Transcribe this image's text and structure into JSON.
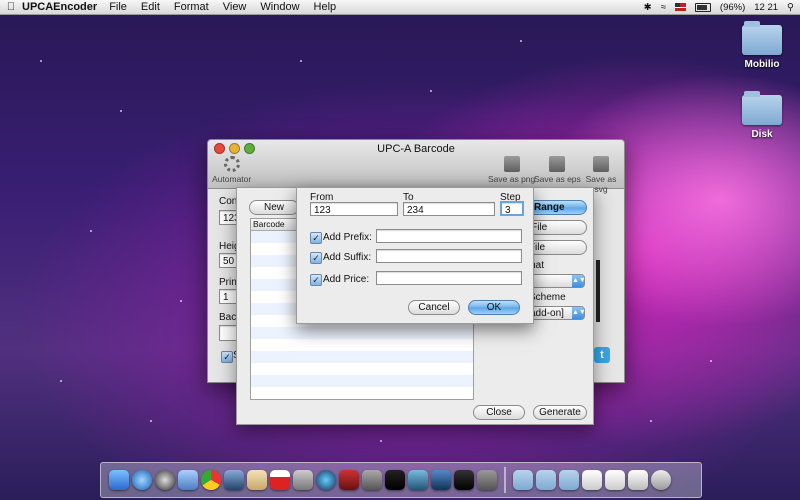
{
  "menubar": {
    "app_name": "UPCAEncoder",
    "items": [
      "File",
      "Edit",
      "Format",
      "View",
      "Window",
      "Help"
    ],
    "battery": "(96%)",
    "clock": "12 21"
  },
  "desktop": {
    "icons": [
      {
        "label": "Mobilio"
      },
      {
        "label": "Disk"
      }
    ]
  },
  "window": {
    "title": "UPC-A Barcode",
    "toolbar": {
      "automator": "Automator",
      "save_png": "Save as png",
      "save_eps": "Save as eps",
      "save_svg": "Save as svg"
    },
    "left": {
      "content_label": "Cont",
      "content_value": "123",
      "height_label": "Heig",
      "height_value": "50",
      "print_label": "Print",
      "print_value": "1",
      "background_label": "Back",
      "show_label": "S"
    }
  },
  "batch_sheet": {
    "new_button": "New",
    "table_header": "Barcode",
    "range_button": "Range",
    "import_button": "ot File",
    "export_button": "rt File",
    "format_label": "rmat",
    "scheme_label": "Scheme",
    "scheme_value": "add-on]",
    "close_button": "Close",
    "generate_button": "Generate"
  },
  "range_sheet": {
    "from_label": "From",
    "from_value": "123",
    "to_label": "To",
    "to_value": "234",
    "step_label": "Step",
    "step_value": "3",
    "add_prefix_label": "Add Prefix:",
    "add_suffix_label": "Add Suffix:",
    "add_price_label": "Add Price:",
    "prefix_value": "",
    "suffix_value": "",
    "price_value": "",
    "cancel_button": "Cancel",
    "ok_button": "OK"
  },
  "colors": {
    "accent_blue": "#5aa5e5",
    "desktop_magenta": "#dc28be"
  }
}
